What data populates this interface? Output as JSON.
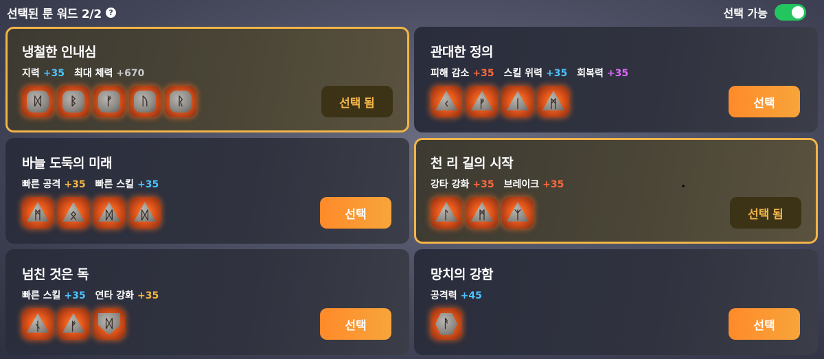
{
  "header": {
    "title": "선택된 룬 워드 2/2",
    "help_icon": "?",
    "available_label": "선택 가능",
    "available_toggle_on": true
  },
  "colors": {
    "blue": "#4cc3ff",
    "orange_red": "#ff6a3d",
    "yellow": "#f5b642",
    "purple": "#e066ff",
    "gray": "#c8c8cc",
    "selected_border": "#f2b548",
    "button": "#ff8a2a"
  },
  "cards": [
    {
      "name": "냉철한 인내심",
      "selected": true,
      "button_label": "선택 됨",
      "stats": [
        {
          "label": "지력",
          "value": "+35",
          "color": "blue"
        },
        {
          "label": "최대 체력",
          "value": "+670",
          "color": "gray"
        }
      ],
      "runes": [
        {
          "glyph": "ᛞ",
          "shape": "round"
        },
        {
          "glyph": "ᛒ",
          "shape": "round"
        },
        {
          "glyph": "ᚠ",
          "shape": "round"
        },
        {
          "glyph": "ᚢ",
          "shape": "round"
        },
        {
          "glyph": "ᚱ",
          "shape": "round"
        }
      ]
    },
    {
      "name": "관대한 정의",
      "selected": false,
      "button_label": "선택",
      "stats": [
        {
          "label": "피해 감소",
          "value": "+35",
          "color": "orange_red"
        },
        {
          "label": "스킬 위력",
          "value": "+35",
          "color": "blue"
        },
        {
          "label": "회복력",
          "value": "+35",
          "color": "purple"
        }
      ],
      "runes": [
        {
          "glyph": "ᚲ",
          "shape": "tri"
        },
        {
          "glyph": "ᚠ",
          "shape": "tri"
        },
        {
          "glyph": "ᛁ",
          "shape": "tri"
        },
        {
          "glyph": "ᛗ",
          "shape": "tri"
        }
      ]
    },
    {
      "name": "바늘 도둑의 미래",
      "selected": false,
      "button_label": "선택",
      "stats": [
        {
          "label": "빠른 공격",
          "value": "+35",
          "color": "yellow"
        },
        {
          "label": "빠른 스킬",
          "value": "+35",
          "color": "blue"
        }
      ],
      "runes": [
        {
          "glyph": "ᛗ",
          "shape": "tri"
        },
        {
          "glyph": "ᛟ",
          "shape": "tri"
        },
        {
          "glyph": "ᛞ",
          "shape": "tri"
        },
        {
          "glyph": "ᛞ",
          "shape": "tri"
        }
      ]
    },
    {
      "name": "천 리 길의 시작",
      "selected": true,
      "button_label": "선택 됨",
      "stats": [
        {
          "label": "강타 강화",
          "value": "+35",
          "color": "orange_red"
        },
        {
          "label": "브레이크",
          "value": "+35",
          "color": "orange_red"
        }
      ],
      "runes": [
        {
          "glyph": "ᛚ",
          "shape": "tri"
        },
        {
          "glyph": "ᛗ",
          "shape": "tri"
        },
        {
          "glyph": "ᛉ",
          "shape": "tri"
        }
      ]
    },
    {
      "name": "넘친 것은 독",
      "selected": false,
      "button_label": "선택",
      "stats": [
        {
          "label": "빠른 스킬",
          "value": "+35",
          "color": "blue"
        },
        {
          "label": "연타 강화",
          "value": "+35",
          "color": "yellow"
        }
      ],
      "runes": [
        {
          "glyph": "ᚾ",
          "shape": "tri"
        },
        {
          "glyph": "ᚠ",
          "shape": "tri"
        },
        {
          "glyph": "ᛞ",
          "shape": "shield"
        }
      ]
    },
    {
      "name": "망치의 강함",
      "selected": false,
      "button_label": "선택",
      "stats": [
        {
          "label": "공격력",
          "value": "+45",
          "color": "blue"
        }
      ],
      "runes": [
        {
          "glyph": "ᚨ",
          "shape": "hex"
        }
      ]
    }
  ]
}
